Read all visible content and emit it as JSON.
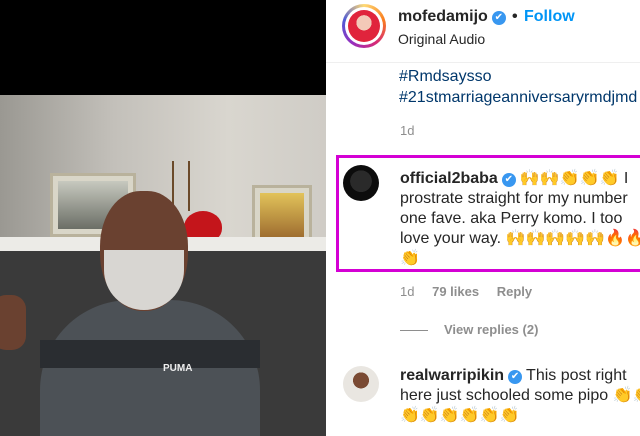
{
  "post": {
    "username": "mofedamijo",
    "separator": "•",
    "follow_label": "Follow",
    "audio": "Original Audio",
    "verified_mark": "✔",
    "hashtags": [
      "#Rmdsaysso",
      "#21stmarriageanniversaryrmdjmd"
    ],
    "time": "1d"
  },
  "video": {
    "shirt_logo": "PUMA"
  },
  "comments": [
    {
      "username": "official2baba",
      "text_line1": "🙌🙌👏👏👏 I",
      "text_line2": "prostrate straight for my number",
      "text_line3": "one fave. aka Perry komo. I too",
      "text_line4": "love your way. 🙌🙌🙌🙌🙌🔥🔥👏👏",
      "text_line5": "👏",
      "time": "1d",
      "likes": "79 likes",
      "reply_label": "Reply",
      "view_replies": "View replies (2)"
    },
    {
      "username": "realwarripikin",
      "text_line1": "This post right",
      "text_line2": "here just schooled some pipo 👏👏",
      "text_line3": "👏👏👏👏👏👏"
    }
  ],
  "colors": {
    "follow_blue": "#0095f6",
    "highlight_border": "#d400d4",
    "verified_blue": "#3897f0"
  }
}
